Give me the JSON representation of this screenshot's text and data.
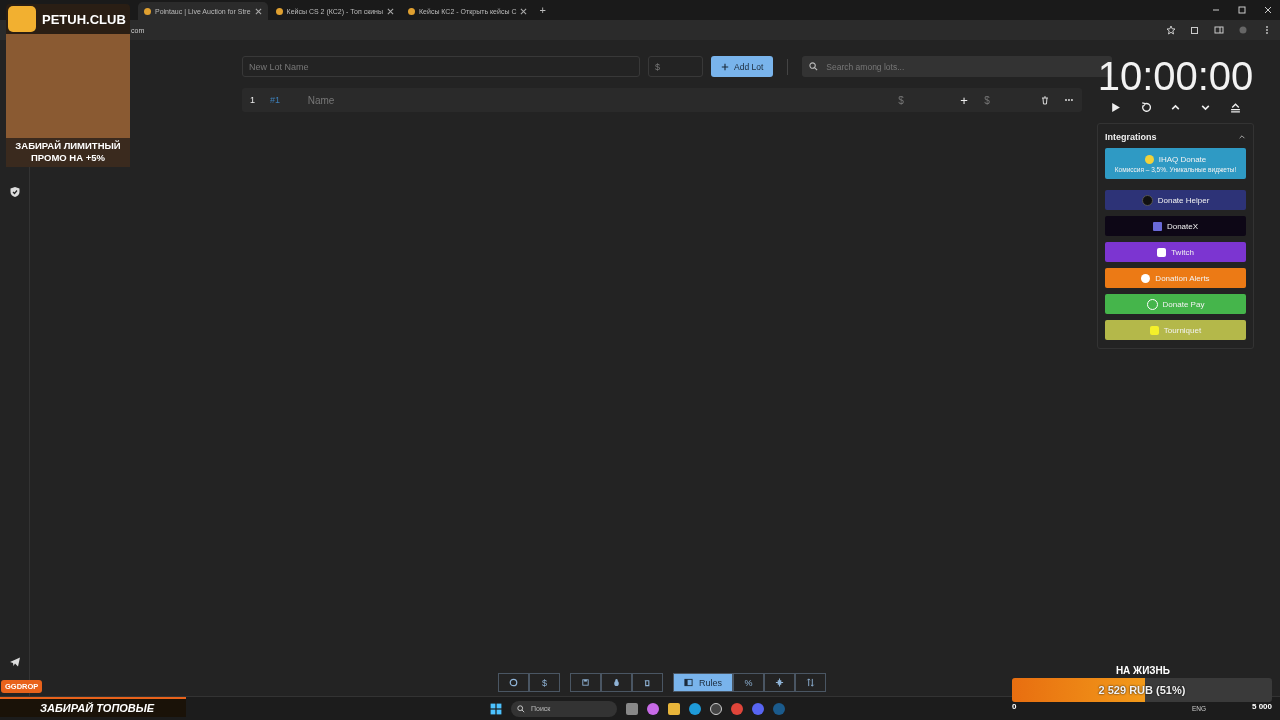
{
  "browser": {
    "tabs": [
      {
        "title": "Pointauc | Live Auction for Stre",
        "selected": true
      },
      {
        "title": "Кейсы CS 2 (КС2) - Топ скины",
        "selected": false
      },
      {
        "title": "Кейсы КС2 - Открыть кейсы С",
        "selected": false
      }
    ],
    "new_tab": "+",
    "address": "com"
  },
  "lot_form": {
    "name_placeholder": "New Lot Name",
    "amount_placeholder": "$",
    "add_button": "Add Lot",
    "search_placeholder": "Search among lots..."
  },
  "lots": [
    {
      "index": "1",
      "id": "#1",
      "name_placeholder": "Name",
      "amount_placeholder": "$",
      "add": "+",
      "add_amount_placeholder": "$"
    }
  ],
  "timer": {
    "time": "10:00:00"
  },
  "integrations": {
    "title": "Integrations",
    "expanded": true,
    "items": [
      {
        "label": "IHAQ Donate",
        "subtitle": "Комиссия – 3,5%. Уникальные виджеты!",
        "color": "#2f9ac4"
      },
      {
        "label": "Donate Helper",
        "color": "#2d3377"
      },
      {
        "label": "DonateX",
        "color": "#0d0716"
      },
      {
        "label": "Twitch",
        "color": "#7c35d1"
      },
      {
        "label": "Donation Alerts",
        "color": "#ec7a15"
      },
      {
        "label": "Donate Pay",
        "color": "#45b54b"
      },
      {
        "label": "Tourniquet",
        "color": "#b4b84a"
      }
    ]
  },
  "toolbar": {
    "groups": [
      [
        {
          "selected": false
        },
        {
          "label": "$",
          "selected": false
        }
      ],
      [
        {
          "selected": false
        },
        {
          "selected": false
        },
        {
          "selected": false
        }
      ],
      [
        {
          "label": "Rules",
          "selected": true
        },
        {
          "label": "%",
          "selected": false
        },
        {
          "selected": false
        },
        {
          "selected": false
        }
      ]
    ]
  },
  "promo_overlay": {
    "brand": "PETUH.CLUB",
    "text": "ЗАБИРАЙ ЛИМИТНЫЙ ПРОМО НА +5%"
  },
  "bottom_banner": {
    "badge": "GGDROP",
    "text": "ЗАБИРАЙ ТОПОВЫЕ"
  },
  "donation_goal": {
    "title": "НА ЖИЗНЬ",
    "level": 0.51,
    "reading": "2 529 RUB (51%)",
    "min": "0",
    "max": "5 000"
  },
  "taskbar": {
    "search_placeholder": "Поиск",
    "language": "ENG"
  }
}
